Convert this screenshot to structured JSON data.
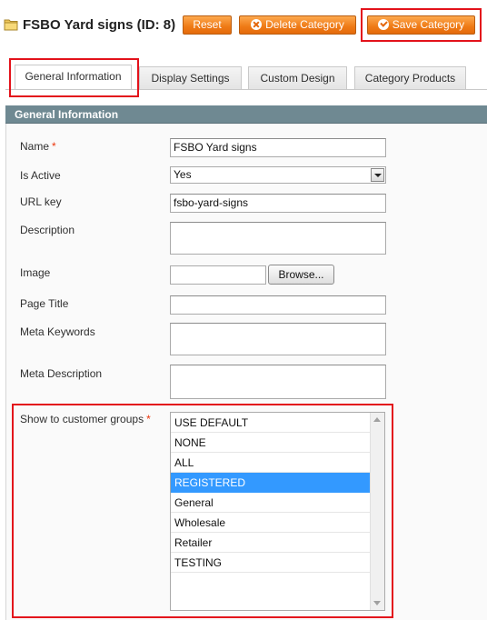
{
  "header": {
    "title": "FSBO Yard signs (ID: 8)",
    "buttons": {
      "reset": "Reset",
      "delete": "Delete Category",
      "save": "Save Category"
    }
  },
  "tabs": [
    {
      "label": "General Information",
      "active": true
    },
    {
      "label": "Display Settings",
      "active": false
    },
    {
      "label": "Custom Design",
      "active": false
    },
    {
      "label": "Category Products",
      "active": false
    }
  ],
  "section": {
    "title": "General Information"
  },
  "form": {
    "name": {
      "label": "Name",
      "required": "*",
      "value": "FSBO Yard signs"
    },
    "is_active": {
      "label": "Is Active",
      "value": "Yes"
    },
    "url_key": {
      "label": "URL key",
      "value": "fsbo-yard-signs"
    },
    "description": {
      "label": "Description",
      "value": ""
    },
    "image": {
      "label": "Image",
      "browse": "Browse..."
    },
    "page_title": {
      "label": "Page Title",
      "value": ""
    },
    "meta_keywords": {
      "label": "Meta Keywords",
      "value": ""
    },
    "meta_description": {
      "label": "Meta Description",
      "value": ""
    },
    "customer_groups": {
      "label": "Show to customer groups",
      "required": "*",
      "options": [
        "USE DEFAULT",
        "NONE",
        "ALL",
        "REGISTERED",
        "General",
        "Wholesale",
        "Retailer",
        "TESTING"
      ],
      "selected": "REGISTERED"
    }
  },
  "colors": {
    "accent_button": "#ef7a16",
    "highlight_box": "#e3121b",
    "section_header": "#6f8992",
    "selected_option": "#3399ff"
  }
}
